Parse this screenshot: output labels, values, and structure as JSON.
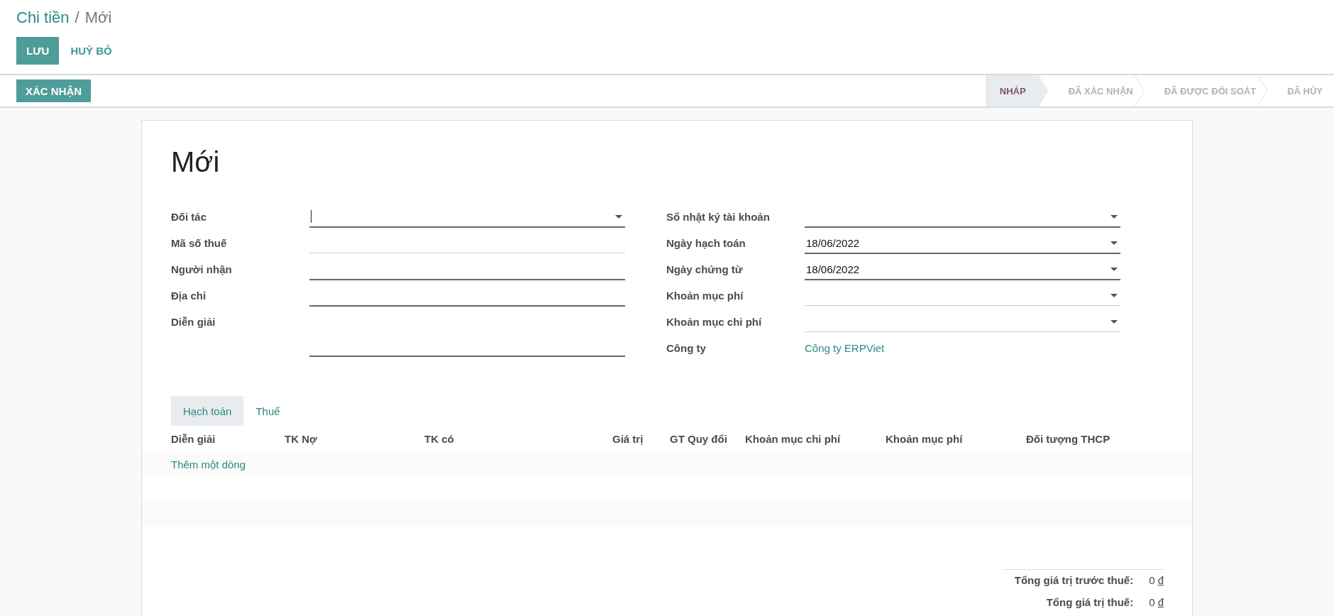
{
  "breadcrumb": {
    "parent": "Chi tiền",
    "separator": "/",
    "current": "Mới"
  },
  "actions": [
    {
      "label": "LƯU",
      "kind": "primary"
    },
    {
      "label": "HUỶ BỎ",
      "kind": "link"
    }
  ],
  "header_buttons": [
    {
      "label": "XÁC NHẬN"
    }
  ],
  "statusbar": [
    {
      "label": "NHÁP",
      "selected": true
    },
    {
      "label": "ĐÃ XÁC NHẬN",
      "selected": false
    },
    {
      "label": "ĐÃ ĐƯỢC ĐỐI SOÁT",
      "selected": false
    },
    {
      "label": "ĐÃ HỦY",
      "selected": false
    }
  ],
  "title": "Mới",
  "left_fields": [
    {
      "label": "Đối tác",
      "kind": "select",
      "required": true,
      "focused": true
    },
    {
      "label": "Mã số thuế",
      "kind": "text",
      "required": false,
      "focused": false
    },
    {
      "label": "Người nhận",
      "kind": "text",
      "required": true,
      "focused": false
    },
    {
      "label": "Địa chỉ",
      "kind": "text",
      "required": true,
      "focused": false
    },
    {
      "label": "Diễn giải",
      "kind": "textarea",
      "required": true,
      "focused": false
    }
  ],
  "right_fields": [
    {
      "label": "Sổ nhật ký tài khoản",
      "kind": "select",
      "required": true,
      "focused": false
    },
    {
      "label": "Ngày hạch toán",
      "kind": "select",
      "required": true,
      "focused": false,
      "value": "18/06/2022"
    },
    {
      "label": "Ngày chứng từ",
      "kind": "select",
      "required": true,
      "focused": false,
      "value": "18/06/2022"
    },
    {
      "label": "Khoản mục phí",
      "kind": "select",
      "required": false,
      "focused": false
    },
    {
      "label": "Khoản mục chi phí",
      "kind": "select",
      "required": false,
      "focused": false
    },
    {
      "label": "Công ty",
      "kind": "link",
      "value": "Công ty ERPViet"
    }
  ],
  "tabs": [
    {
      "label": "Hạch toán",
      "selected": true
    },
    {
      "label": "Thuế",
      "selected": false
    }
  ],
  "table": {
    "columns": [
      "Diễn giải",
      "TK Nợ",
      "TK có",
      "Giá trị",
      "GT Quy đổi",
      "Khoản mục chi phí",
      "Khoản mục phí",
      "Đối tượng THCP"
    ],
    "add_line": "Thêm một dòng"
  },
  "totals": [
    {
      "label": "Tổng giá trị trước thuế:",
      "amount": "0",
      "currency": "đ"
    },
    {
      "label": "Tổng giá trị thuế:",
      "amount": "0",
      "currency": "đ"
    }
  ]
}
